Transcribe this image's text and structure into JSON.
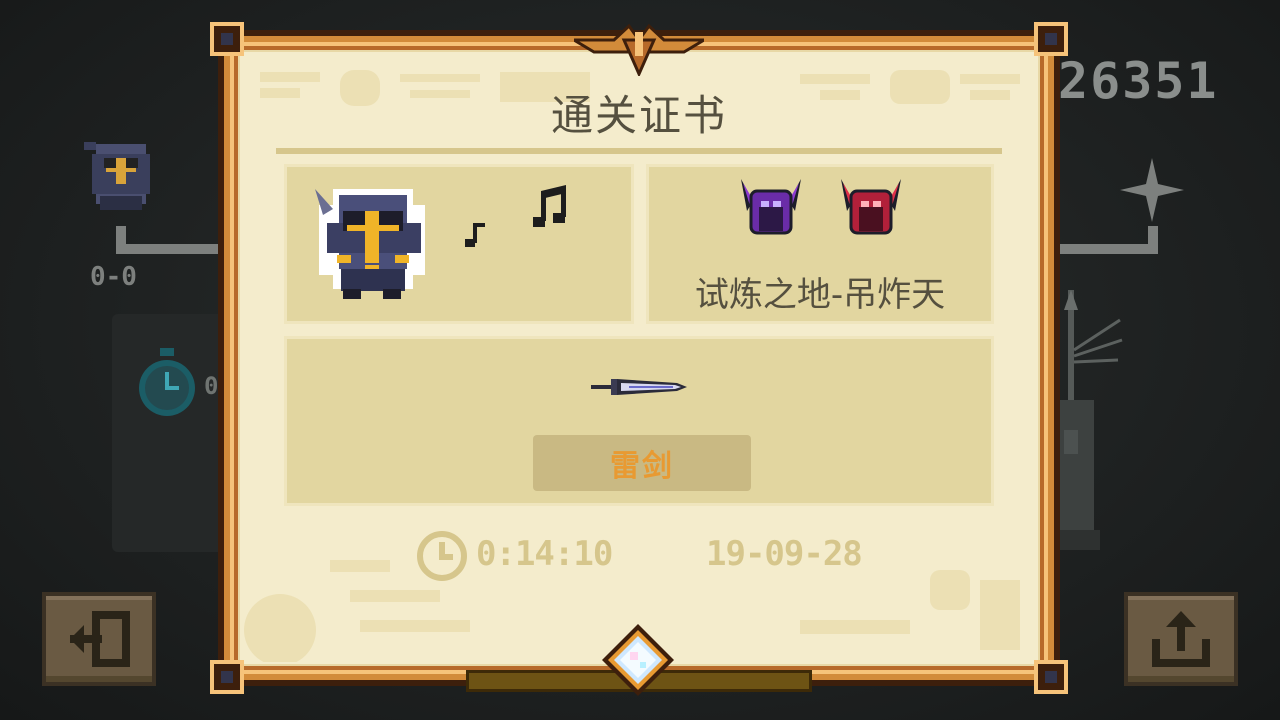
{
  "background": {
    "score": "26351",
    "player_score": "0-0",
    "timer_partial": "0",
    "buttons": {
      "exit_icon": "exit-door-icon",
      "share_icon": "share-upload-icon"
    }
  },
  "certificate": {
    "title": "通关证书",
    "stage_name": "试炼之地-吊炸天",
    "weapon_name": "雷剑",
    "time": "0:14:10",
    "date": "19-09-28",
    "icons": {
      "hero": "knight-hero-icon",
      "notes": "music-note-icon",
      "masks": [
        "purple-demon-mask-icon",
        "red-demon-mask-icon"
      ],
      "weapon": "thunder-sword-icon",
      "clock": "clock-icon",
      "gem": "diamond-gem-icon"
    }
  },
  "colors": {
    "parchment": "#f4eccc",
    "box": "#e2d6a0",
    "frame_orange": "#d28b3a",
    "frame_dark": "#3d1f0c",
    "weapon_label": "#e89a32",
    "text_dark": "#55503f",
    "faded_text": "#d6c68c"
  }
}
